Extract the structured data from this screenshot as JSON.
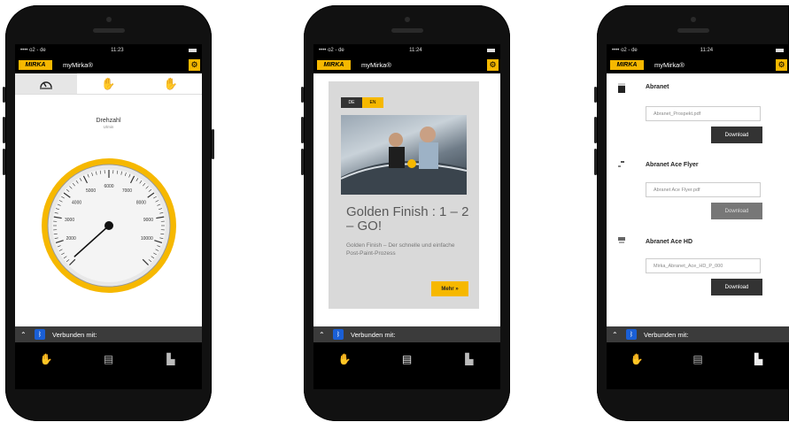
{
  "phone1": {
    "status": {
      "carrier": "•••• o2 - de",
      "time": "11:23"
    },
    "app": {
      "logo": "MIRKA",
      "title": "myMirka®"
    },
    "tabs": [
      "gauge-icon",
      "hand-vibration-icon",
      "hand-dust-icon"
    ],
    "gauge": {
      "title": "Drehzahl",
      "subtitle": "U/min",
      "ticks": [
        "2000",
        "3000",
        "4000",
        "5000",
        "6000",
        "7000",
        "8000",
        "9000",
        "10000"
      ],
      "needle_value": 1000
    },
    "connection": {
      "label": "Verbunden mit:"
    },
    "nav": [
      "hand-icon",
      "device-icon",
      "book-icon"
    ]
  },
  "phone2": {
    "status": {
      "carrier": "•••• o2 - de",
      "time": "11:24"
    },
    "app": {
      "logo": "MIRKA",
      "title": "myMirka®"
    },
    "lang": {
      "de": "DE",
      "en": "EN"
    },
    "headline": "Golden Finish : 1 – 2 – GO!",
    "description": "Golden Finish – Der schnelle und einfache Post-Paint-Prozess",
    "more_button": "Mehr »",
    "connection": {
      "label": "Verbunden mit:"
    }
  },
  "phone3": {
    "status": {
      "carrier": "•••• o2 - de",
      "time": "11:24"
    },
    "app": {
      "logo": "MIRKA",
      "title": "myMirka®"
    },
    "downloads": [
      {
        "name": "Abranet",
        "file": "Abranet_Prospekt.pdf",
        "button": "Download"
      },
      {
        "name": "Abranet Ace Flyer",
        "file": "Abranet Ace Flyer.pdf",
        "button": "Download"
      },
      {
        "name": "Abranet Ace HD",
        "file": "Mirka_Abranet_Ace_HD_P_000",
        "button": "Download"
      }
    ],
    "connection": {
      "label": "Verbunden mit:"
    }
  },
  "colors": {
    "accent": "#f6b800",
    "bluetooth": "#1a5fd6",
    "bar": "#3b3b3b"
  }
}
